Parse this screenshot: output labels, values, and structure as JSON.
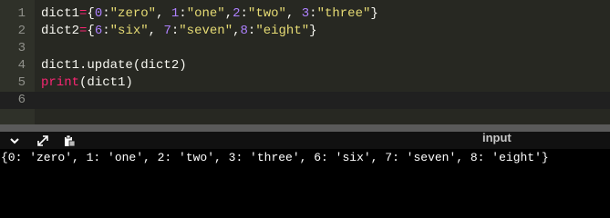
{
  "editor": {
    "lines": [
      {
        "number": "1",
        "tokens": [
          {
            "t": "dict1",
            "c": "ident"
          },
          {
            "t": "=",
            "c": "op"
          },
          {
            "t": "{",
            "c": "punc"
          },
          {
            "t": "0",
            "c": "num"
          },
          {
            "t": ":",
            "c": "punc"
          },
          {
            "t": "\"zero\"",
            "c": "str"
          },
          {
            "t": ", ",
            "c": "punc"
          },
          {
            "t": "1",
            "c": "num"
          },
          {
            "t": ":",
            "c": "punc"
          },
          {
            "t": "\"one\"",
            "c": "str"
          },
          {
            "t": ",",
            "c": "punc"
          },
          {
            "t": "2",
            "c": "num"
          },
          {
            "t": ":",
            "c": "punc"
          },
          {
            "t": "\"two\"",
            "c": "str"
          },
          {
            "t": ", ",
            "c": "punc"
          },
          {
            "t": "3",
            "c": "num"
          },
          {
            "t": ":",
            "c": "punc"
          },
          {
            "t": "\"three\"",
            "c": "str"
          },
          {
            "t": "}",
            "c": "punc"
          }
        ]
      },
      {
        "number": "2",
        "tokens": [
          {
            "t": "dict2",
            "c": "ident"
          },
          {
            "t": "=",
            "c": "op"
          },
          {
            "t": "{",
            "c": "punc"
          },
          {
            "t": "6",
            "c": "num"
          },
          {
            "t": ":",
            "c": "punc"
          },
          {
            "t": "\"six\"",
            "c": "str"
          },
          {
            "t": ", ",
            "c": "punc"
          },
          {
            "t": "7",
            "c": "num"
          },
          {
            "t": ":",
            "c": "punc"
          },
          {
            "t": "\"seven\"",
            "c": "str"
          },
          {
            "t": ",",
            "c": "punc"
          },
          {
            "t": "8",
            "c": "num"
          },
          {
            "t": ":",
            "c": "punc"
          },
          {
            "t": "\"eight\"",
            "c": "str"
          },
          {
            "t": "}",
            "c": "punc"
          }
        ]
      },
      {
        "number": "3",
        "tokens": []
      },
      {
        "number": "4",
        "tokens": [
          {
            "t": "dict1.update(dict2)",
            "c": "ident"
          }
        ]
      },
      {
        "number": "5",
        "tokens": [
          {
            "t": "print",
            "c": "kw"
          },
          {
            "t": "(dict1)",
            "c": "ident"
          }
        ]
      },
      {
        "number": "6",
        "tokens": [],
        "active": true
      }
    ]
  },
  "toolbar": {
    "icons": [
      "chevron-down-icon",
      "expand-icon",
      "paste-icon"
    ],
    "input_label": "input"
  },
  "output": {
    "text": "{0: 'zero', 1: 'one', 2: 'two', 3: 'three', 6: 'six', 7: 'seven', 8: 'eight'}"
  },
  "colors": {
    "editor_bg": "#272822",
    "gutter_bg": "#2f3129",
    "line_number": "#8f908a",
    "text": "#f8f8f2",
    "operator": "#f92672",
    "number": "#ae81ff",
    "string": "#e6db74",
    "keyword": "#f92672",
    "splitter": "#5a5a5a",
    "output_bg": "#000000",
    "output_text": "#ffffff"
  }
}
